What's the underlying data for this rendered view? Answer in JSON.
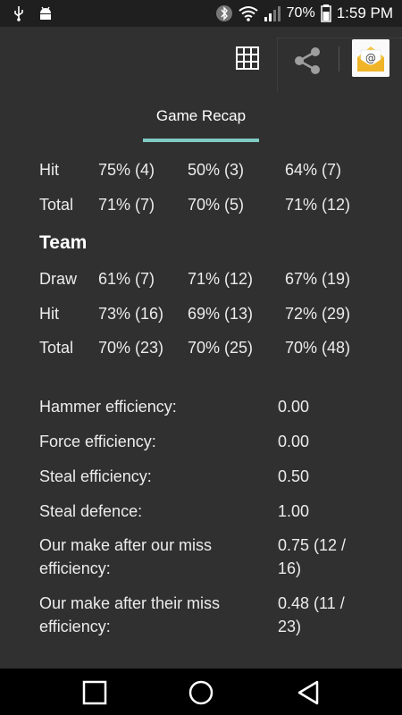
{
  "status_bar": {
    "battery": "70%",
    "time": "1:59 PM"
  },
  "toolbar": {
    "icons": [
      "grid-icon",
      "share-icon",
      "email-icon"
    ]
  },
  "tabs": [
    {
      "label": "Game Recap"
    }
  ],
  "player_rows": [
    {
      "label": "Hit",
      "col1": "75% (4)",
      "col2": "50% (3)",
      "col3": "64% (7)"
    },
    {
      "label": "Total",
      "col1": "71% (7)",
      "col2": "70% (5)",
      "col3": "71% (12)"
    }
  ],
  "team": {
    "heading": "Team",
    "rows": [
      {
        "label": "Draw",
        "col1": "61% (7)",
        "col2": "71% (12)",
        "col3": "67% (19)"
      },
      {
        "label": "Hit",
        "col1": "73% (16)",
        "col2": "69% (13)",
        "col3": "72% (29)"
      },
      {
        "label": "Total",
        "col1": "70% (23)",
        "col2": "70% (25)",
        "col3": "70% (48)"
      }
    ]
  },
  "metrics": [
    {
      "label": "Hammer efficiency:",
      "value": "0.00"
    },
    {
      "label": "Force efficiency:",
      "value": "0.00"
    },
    {
      "label": "Steal efficiency:",
      "value": "0.50"
    },
    {
      "label": "Steal defence:",
      "value": "1.00"
    },
    {
      "label": "Our make after our miss efficiency:",
      "value": "0.75 (12 / 16)"
    },
    {
      "label": "Our make after their miss efficiency:",
      "value": "0.48 (11 / 23)"
    }
  ],
  "nav_bar": {
    "buttons": [
      "recents-icon",
      "home-icon",
      "back-icon"
    ]
  }
}
